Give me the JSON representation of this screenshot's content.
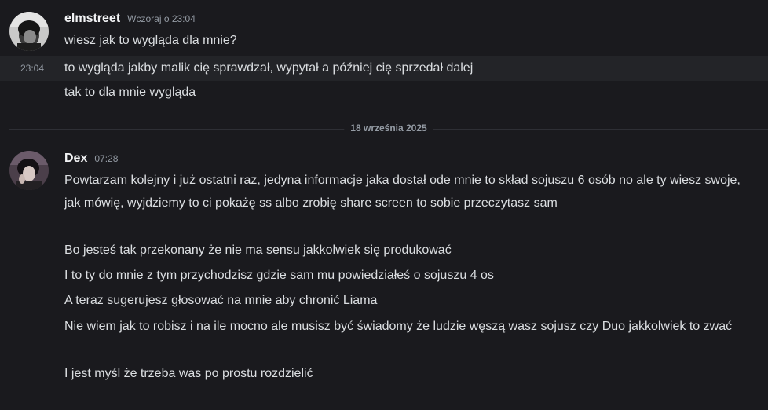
{
  "messages": {
    "group1": {
      "username": "elmstreet",
      "timestamp": "Wczoraj o 23:04",
      "lines": [
        "wiesz jak to wygląda dla mnie?",
        "to wygląda jakby malik cię sprawdzał, wypytał a później cię sprzedał dalej",
        "tak to dla mnie wygląda"
      ],
      "hover_time": "23:04"
    },
    "date_divider": "18 września 2025",
    "group2": {
      "username": "Dex",
      "timestamp": "07:28",
      "lines": [
        "Powtarzam kolejny i już ostatni raz, jedyna informacje jaka dostał ode mnie to skład sojuszu 6 osób no ale ty wiesz swoje, jak mówię, wyjdziemy to ci pokażę ss albo zrobię share screen to sobie przeczytasz sam",
        "Bo jesteś tak przekonany że nie ma sensu jakkolwiek się produkować",
        "I to ty do mnie z tym przychodzisz gdzie sam mu powiedziałeś o sojuszu 4 os",
        "A teraz sugerujesz głosować na mnie aby chronić Liama",
        "Nie wiem jak to robisz i na ile mocno ale musisz być świadomy że ludzie węszą wasz sojusz czy Duo jakkolwiek to zwać",
        "I jest myśl że trzeba was po prostu rozdzielić"
      ]
    }
  }
}
